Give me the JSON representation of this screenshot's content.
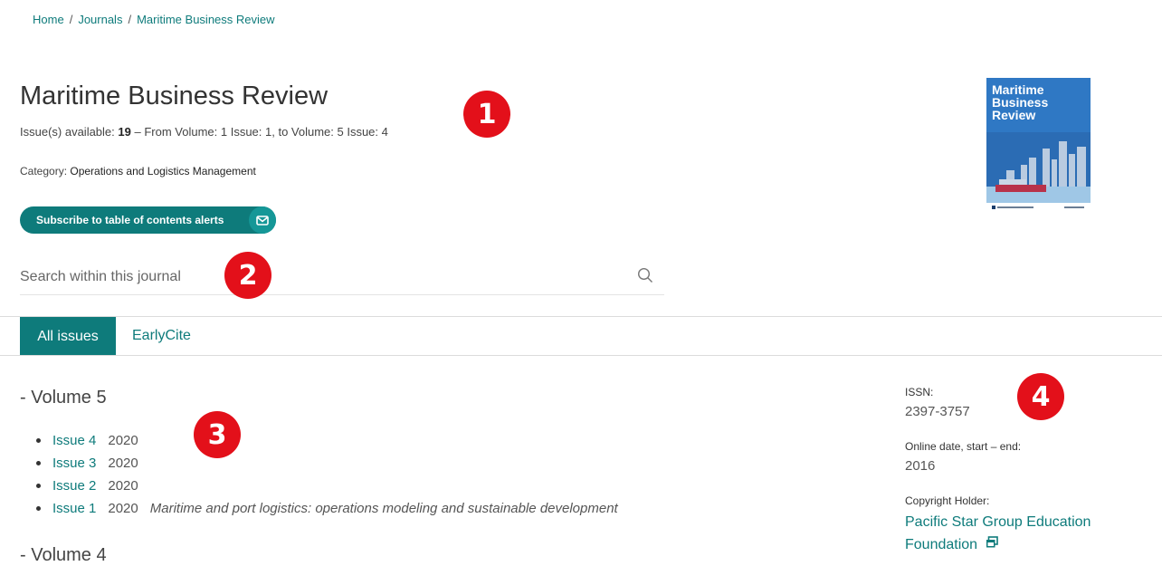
{
  "breadcrumb": {
    "home": "Home",
    "journals": "Journals",
    "current": "Maritime Business Review",
    "sep": "/"
  },
  "journal": {
    "title": "Maritime Business Review",
    "issues_prefix": "Issue(s) available:",
    "issues_count": "19",
    "issues_suffix": "– From Volume: 1 Issue: 1, to Volume: 5 Issue: 4",
    "category_label": "Category:",
    "category_value": "Operations and Logistics Management"
  },
  "subscribe": {
    "label": "Subscribe to table of contents alerts",
    "icon": "mail-icon"
  },
  "search": {
    "placeholder": "Search within this journal",
    "value": ""
  },
  "cover": {
    "text": "Maritime Business Review"
  },
  "tabs": {
    "all": "All issues",
    "early": "EarlyCite"
  },
  "volumes": [
    {
      "label": "-  Volume 5",
      "issues": [
        {
          "label": "Issue 4",
          "year": "2020",
          "desc": ""
        },
        {
          "label": "Issue 3",
          "year": "2020",
          "desc": ""
        },
        {
          "label": "Issue 2",
          "year": "2020",
          "desc": ""
        },
        {
          "label": "Issue 1",
          "year": "2020",
          "desc": "Maritime and port logistics: operations modeling and sustainable development"
        }
      ]
    },
    {
      "label": "-  Volume 4",
      "issues": []
    }
  ],
  "info": {
    "issn_label": "ISSN:",
    "issn_value": "2397-3757",
    "online_label": "Online date, start – end:",
    "online_value": "2016",
    "holder_label": "Copyright Holder:",
    "holder_value": "Pacific Star Group Education Foundation"
  },
  "badges": [
    "1",
    "2",
    "3",
    "4"
  ],
  "colors": {
    "accent": "#0e7b7b",
    "badge": "#e3101a"
  }
}
